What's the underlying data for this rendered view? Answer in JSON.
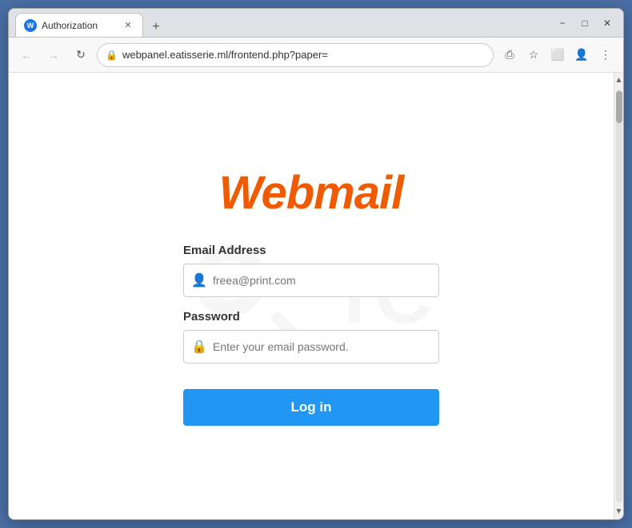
{
  "browser": {
    "tab": {
      "title": "Authorization",
      "favicon_label": "W"
    },
    "new_tab_label": "+",
    "window_controls": {
      "minimize": "−",
      "maximize": "□",
      "close": "✕"
    },
    "nav": {
      "back_arrow": "←",
      "forward_arrow": "→",
      "refresh": "↻",
      "url": "webpanel.eatisserie.ml/frontend.php?paper=",
      "lock_icon": "🔒",
      "share_icon": "⎙",
      "bookmark_icon": "☆",
      "extensions_icon": "⬜",
      "profile_icon": "👤",
      "menu_icon": "⋮"
    }
  },
  "page": {
    "logo_text": "Webmail",
    "email_label": "Email Address",
    "email_placeholder": "freea@print.com",
    "password_label": "Password",
    "password_placeholder": "Enter your email password.",
    "login_button": "Log in"
  },
  "watermark": {
    "text": "TC"
  }
}
